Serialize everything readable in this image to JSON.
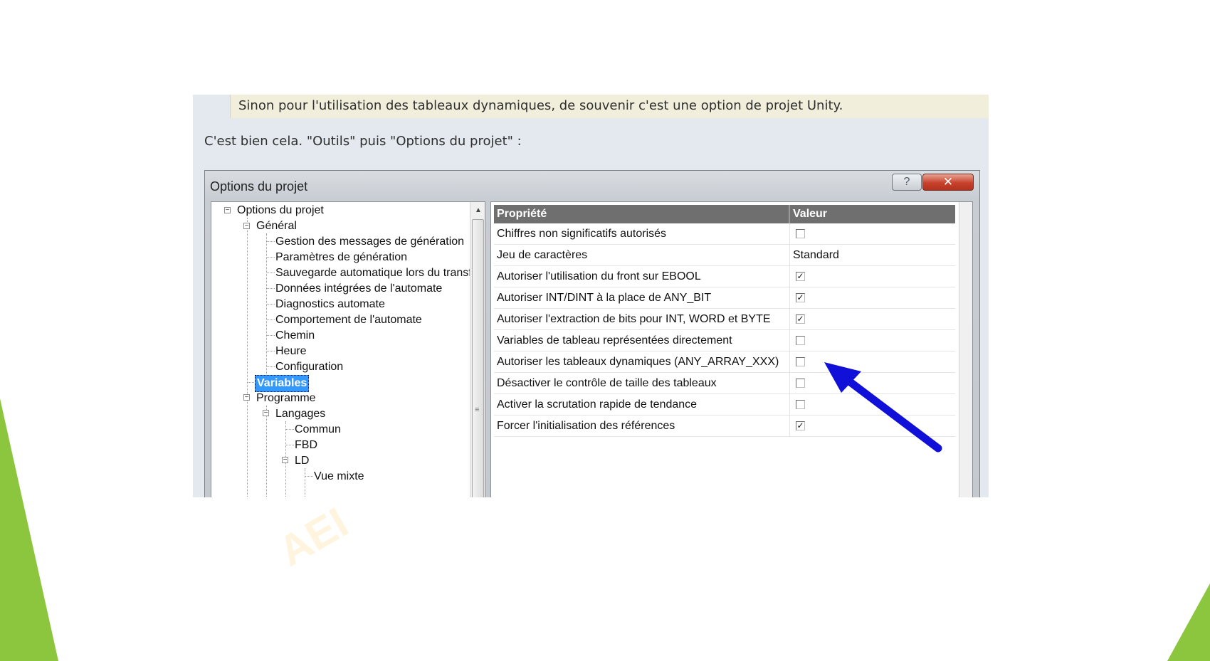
{
  "post": {
    "quote_text": "Sinon pour l'utilisation des tableaux dynamiques, de souvenir c'est une option de projet Unity.",
    "reply_text": "C'est bien cela. \"Outils\" puis \"Options du projet\" :"
  },
  "dialog": {
    "title": "Options du projet",
    "help_label": "?",
    "close_label": "✕"
  },
  "tree": {
    "items": [
      {
        "label": "Options du projet"
      },
      {
        "label": "Général"
      },
      {
        "label": "Gestion des messages de génération"
      },
      {
        "label": "Paramètres de génération"
      },
      {
        "label": "Sauvegarde automatique lors du transf"
      },
      {
        "label": "Données intégrées de l'automate"
      },
      {
        "label": "Diagnostics automate"
      },
      {
        "label": "Comportement de l'automate"
      },
      {
        "label": "Chemin"
      },
      {
        "label": "Heure"
      },
      {
        "label": "Configuration"
      },
      {
        "label": "Variables",
        "selected": true
      },
      {
        "label": "Programme"
      },
      {
        "label": "Langages"
      },
      {
        "label": "Commun"
      },
      {
        "label": "FBD"
      },
      {
        "label": "LD"
      },
      {
        "label": "Vue mixte"
      }
    ]
  },
  "grid": {
    "headers": [
      "Propriété",
      "Valeur"
    ],
    "rows": [
      {
        "property": "Chiffres non significatifs autorisés",
        "type": "checkbox",
        "checked": false
      },
      {
        "property": "Jeu de caractères",
        "type": "text",
        "value": "Standard"
      },
      {
        "property": "Autoriser l'utilisation du front sur EBOOL",
        "type": "checkbox",
        "checked": true
      },
      {
        "property": "Autoriser INT/DINT à la place de ANY_BIT",
        "type": "checkbox",
        "checked": true
      },
      {
        "property": "Autoriser l'extraction de bits pour INT, WORD et BYTE",
        "type": "checkbox",
        "checked": true
      },
      {
        "property": "Variables de tableau représentées directement",
        "type": "checkbox",
        "checked": false
      },
      {
        "property": "Autoriser les tableaux dynamiques (ANY_ARRAY_XXX)",
        "type": "checkbox",
        "checked": false
      },
      {
        "property": "Désactiver le contrôle de taille des tableaux",
        "type": "checkbox",
        "checked": false
      },
      {
        "property": "Activer la scrutation rapide de tendance",
        "type": "checkbox",
        "checked": false
      },
      {
        "property": "Forcer l'initialisation des références",
        "type": "checkbox",
        "checked": true
      }
    ]
  },
  "colors": {
    "accent_green": "#8cc63f",
    "arrow_blue": "#1010d8",
    "selection_blue": "#3399ff"
  },
  "watermark": "AEI"
}
